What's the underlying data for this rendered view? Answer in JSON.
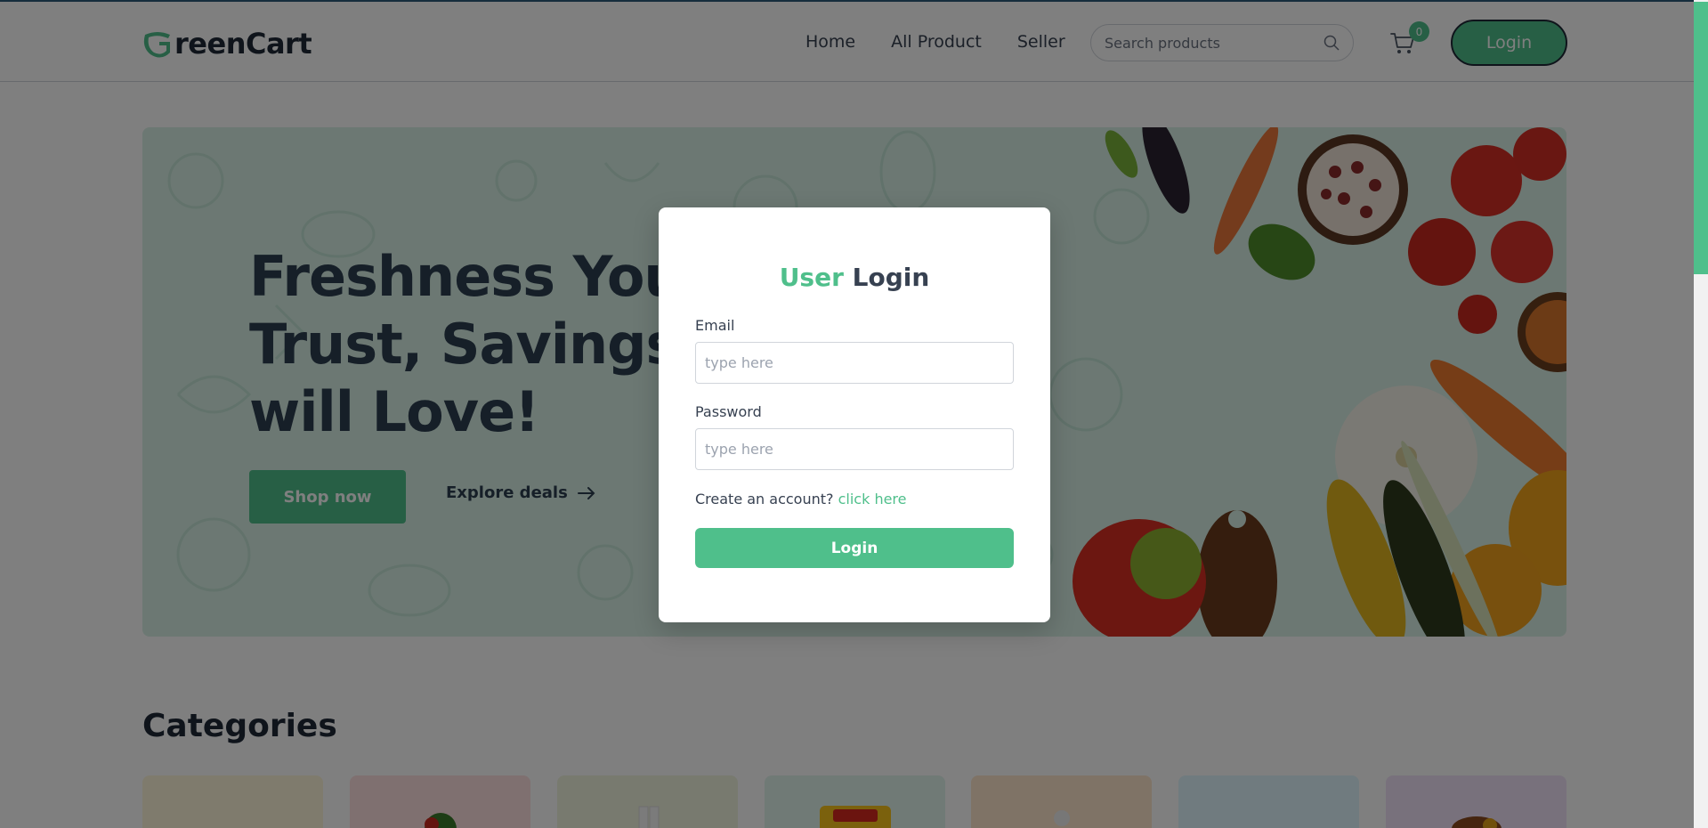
{
  "brand": {
    "name": "reenCart",
    "logo_icon": "greencart-g-logo"
  },
  "nav": {
    "links": [
      "Home",
      "All Product",
      "Seller"
    ],
    "search_placeholder": "Search products",
    "cart_count": "0",
    "login_label": "Login"
  },
  "hero": {
    "title_lines": [
      "Freshness You Can",
      "Trust, Savings You",
      "will Love!"
    ],
    "shop_label": "Shop now",
    "explore_label": "Explore deals"
  },
  "categories": {
    "title": "Categories",
    "card_colors": [
      "#FEF6DA",
      "#FEE0E0",
      "#F0F5DE",
      "#E1F5EC",
      "#FEE6CD",
      "#E0F6FE",
      "#F1E3F9"
    ]
  },
  "modal": {
    "title_accent": "User",
    "title_rest": "Login",
    "email_label": "Email",
    "email_placeholder": "type here",
    "password_label": "Password",
    "password_placeholder": "type here",
    "create_text": "Create an account?",
    "create_link": "click here",
    "login_label": "Login"
  },
  "colors": {
    "accent": "#4fbf8b",
    "text_dark": "#2d3e50"
  }
}
